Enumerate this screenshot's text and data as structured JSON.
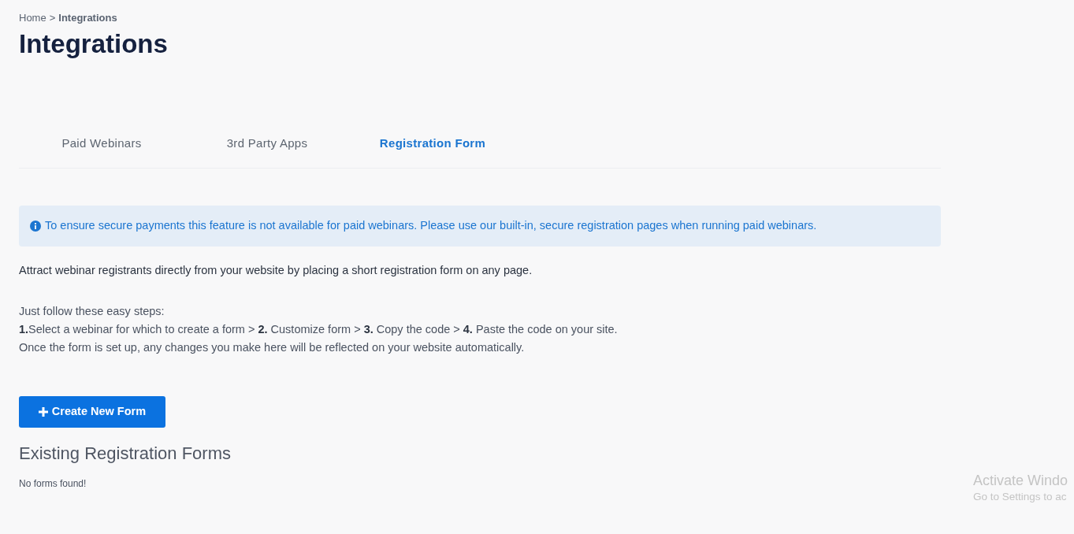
{
  "breadcrumb": {
    "home": "Home",
    "separator": ">",
    "current": "Integrations"
  },
  "title": "Integrations",
  "tabs": [
    {
      "label": "Paid Webinars",
      "selected": false
    },
    {
      "label": "3rd Party Apps",
      "selected": false
    },
    {
      "label": "Registration Form",
      "selected": true
    }
  ],
  "notice": "To ensure secure payments this feature is not available for paid webinars. Please use our built-in, secure registration pages when running paid webinars.",
  "intro": "Attract webinar registrants directly from your website by placing a short registration form on any page.",
  "steps": [
    "Just follow these easy steps:",
    "**1.**Select a webinar for which to create a form > **2.** Customize form > **3.** Copy the code > **4.** Paste the code on your site.",
    "Once the form is set up, any changes you make here will be reflected on your website automatically."
  ],
  "create_button": "Create New Form",
  "existing_heading": "Existing Registration Forms",
  "empty_message": "No forms found!",
  "os_overlay": {
    "title": "Activate Windo",
    "subtitle": "Go to Settings to ac"
  }
}
